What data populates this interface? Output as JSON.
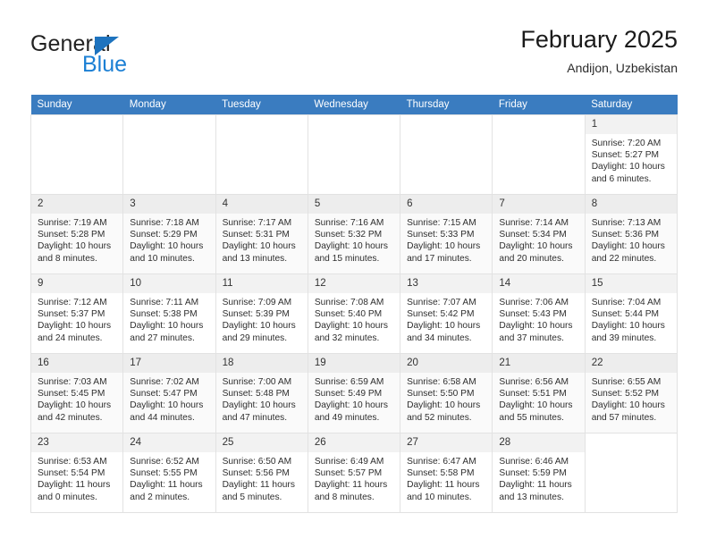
{
  "brand": {
    "name_top": "General",
    "name_bottom": "Blue"
  },
  "header": {
    "title": "February 2025",
    "location": "Andijon, Uzbekistan"
  },
  "weekday_headers": [
    "Sunday",
    "Monday",
    "Tuesday",
    "Wednesday",
    "Thursday",
    "Friday",
    "Saturday"
  ],
  "colors": {
    "header_bar": "#3a7cc0",
    "brand_blue": "#1b7fd4",
    "triangle": "#1e73be",
    "cell_border": "#e2e2e2",
    "daynum_bg": "#f2f2f2"
  },
  "weeks": [
    {
      "days": [
        {
          "day": "",
          "empty": true
        },
        {
          "day": "",
          "empty": true
        },
        {
          "day": "",
          "empty": true
        },
        {
          "day": "",
          "empty": true
        },
        {
          "day": "",
          "empty": true
        },
        {
          "day": "",
          "empty": true
        },
        {
          "day": "1",
          "sunrise": "Sunrise: 7:20 AM",
          "sunset": "Sunset: 5:27 PM",
          "daylight": "Daylight: 10 hours and 6 minutes."
        }
      ]
    },
    {
      "days": [
        {
          "day": "2",
          "sunrise": "Sunrise: 7:19 AM",
          "sunset": "Sunset: 5:28 PM",
          "daylight": "Daylight: 10 hours and 8 minutes."
        },
        {
          "day": "3",
          "sunrise": "Sunrise: 7:18 AM",
          "sunset": "Sunset: 5:29 PM",
          "daylight": "Daylight: 10 hours and 10 minutes."
        },
        {
          "day": "4",
          "sunrise": "Sunrise: 7:17 AM",
          "sunset": "Sunset: 5:31 PM",
          "daylight": "Daylight: 10 hours and 13 minutes."
        },
        {
          "day": "5",
          "sunrise": "Sunrise: 7:16 AM",
          "sunset": "Sunset: 5:32 PM",
          "daylight": "Daylight: 10 hours and 15 minutes."
        },
        {
          "day": "6",
          "sunrise": "Sunrise: 7:15 AM",
          "sunset": "Sunset: 5:33 PM",
          "daylight": "Daylight: 10 hours and 17 minutes."
        },
        {
          "day": "7",
          "sunrise": "Sunrise: 7:14 AM",
          "sunset": "Sunset: 5:34 PM",
          "daylight": "Daylight: 10 hours and 20 minutes."
        },
        {
          "day": "8",
          "sunrise": "Sunrise: 7:13 AM",
          "sunset": "Sunset: 5:36 PM",
          "daylight": "Daylight: 10 hours and 22 minutes."
        }
      ]
    },
    {
      "days": [
        {
          "day": "9",
          "sunrise": "Sunrise: 7:12 AM",
          "sunset": "Sunset: 5:37 PM",
          "daylight": "Daylight: 10 hours and 24 minutes."
        },
        {
          "day": "10",
          "sunrise": "Sunrise: 7:11 AM",
          "sunset": "Sunset: 5:38 PM",
          "daylight": "Daylight: 10 hours and 27 minutes."
        },
        {
          "day": "11",
          "sunrise": "Sunrise: 7:09 AM",
          "sunset": "Sunset: 5:39 PM",
          "daylight": "Daylight: 10 hours and 29 minutes."
        },
        {
          "day": "12",
          "sunrise": "Sunrise: 7:08 AM",
          "sunset": "Sunset: 5:40 PM",
          "daylight": "Daylight: 10 hours and 32 minutes."
        },
        {
          "day": "13",
          "sunrise": "Sunrise: 7:07 AM",
          "sunset": "Sunset: 5:42 PM",
          "daylight": "Daylight: 10 hours and 34 minutes."
        },
        {
          "day": "14",
          "sunrise": "Sunrise: 7:06 AM",
          "sunset": "Sunset: 5:43 PM",
          "daylight": "Daylight: 10 hours and 37 minutes."
        },
        {
          "day": "15",
          "sunrise": "Sunrise: 7:04 AM",
          "sunset": "Sunset: 5:44 PM",
          "daylight": "Daylight: 10 hours and 39 minutes."
        }
      ]
    },
    {
      "days": [
        {
          "day": "16",
          "sunrise": "Sunrise: 7:03 AM",
          "sunset": "Sunset: 5:45 PM",
          "daylight": "Daylight: 10 hours and 42 minutes."
        },
        {
          "day": "17",
          "sunrise": "Sunrise: 7:02 AM",
          "sunset": "Sunset: 5:47 PM",
          "daylight": "Daylight: 10 hours and 44 minutes."
        },
        {
          "day": "18",
          "sunrise": "Sunrise: 7:00 AM",
          "sunset": "Sunset: 5:48 PM",
          "daylight": "Daylight: 10 hours and 47 minutes."
        },
        {
          "day": "19",
          "sunrise": "Sunrise: 6:59 AM",
          "sunset": "Sunset: 5:49 PM",
          "daylight": "Daylight: 10 hours and 49 minutes."
        },
        {
          "day": "20",
          "sunrise": "Sunrise: 6:58 AM",
          "sunset": "Sunset: 5:50 PM",
          "daylight": "Daylight: 10 hours and 52 minutes."
        },
        {
          "day": "21",
          "sunrise": "Sunrise: 6:56 AM",
          "sunset": "Sunset: 5:51 PM",
          "daylight": "Daylight: 10 hours and 55 minutes."
        },
        {
          "day": "22",
          "sunrise": "Sunrise: 6:55 AM",
          "sunset": "Sunset: 5:52 PM",
          "daylight": "Daylight: 10 hours and 57 minutes."
        }
      ]
    },
    {
      "days": [
        {
          "day": "23",
          "sunrise": "Sunrise: 6:53 AM",
          "sunset": "Sunset: 5:54 PM",
          "daylight": "Daylight: 11 hours and 0 minutes."
        },
        {
          "day": "24",
          "sunrise": "Sunrise: 6:52 AM",
          "sunset": "Sunset: 5:55 PM",
          "daylight": "Daylight: 11 hours and 2 minutes."
        },
        {
          "day": "25",
          "sunrise": "Sunrise: 6:50 AM",
          "sunset": "Sunset: 5:56 PM",
          "daylight": "Daylight: 11 hours and 5 minutes."
        },
        {
          "day": "26",
          "sunrise": "Sunrise: 6:49 AM",
          "sunset": "Sunset: 5:57 PM",
          "daylight": "Daylight: 11 hours and 8 minutes."
        },
        {
          "day": "27",
          "sunrise": "Sunrise: 6:47 AM",
          "sunset": "Sunset: 5:58 PM",
          "daylight": "Daylight: 11 hours and 10 minutes."
        },
        {
          "day": "28",
          "sunrise": "Sunrise: 6:46 AM",
          "sunset": "Sunset: 5:59 PM",
          "daylight": "Daylight: 11 hours and 13 minutes."
        },
        {
          "day": "",
          "empty": true
        }
      ]
    }
  ]
}
